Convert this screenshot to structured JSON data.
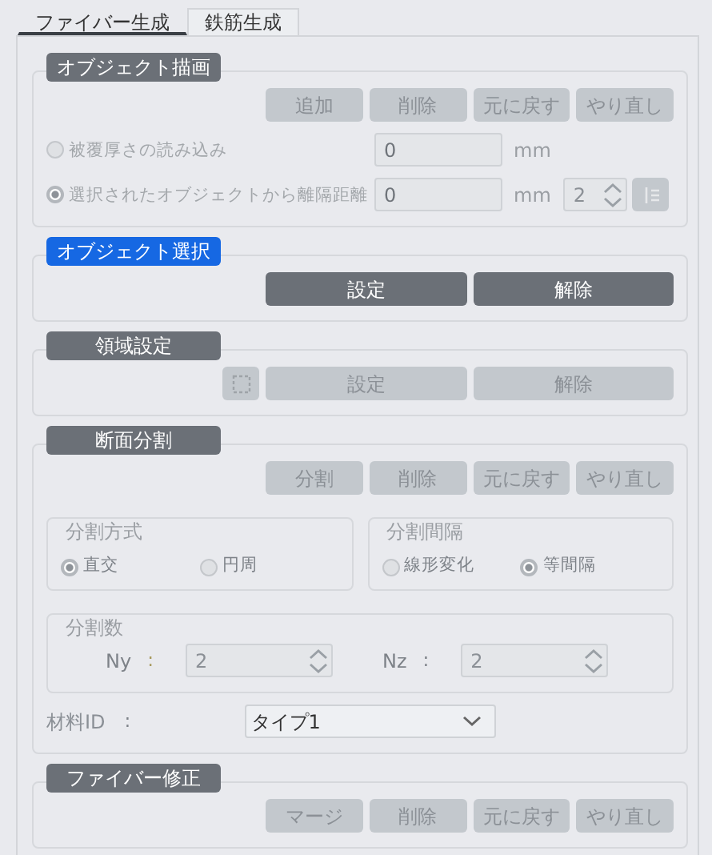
{
  "tabs": [
    {
      "label": "ファイバー生成",
      "selected": true
    },
    {
      "label": "鉄筋生成",
      "selected": false
    }
  ],
  "sections": [
    {
      "title": "オブジェクト描画",
      "selected": false,
      "buttons": [
        {
          "label": "追加",
          "disabled": true
        },
        {
          "label": "削除",
          "disabled": true
        },
        {
          "label": "元に戻す",
          "disabled": true
        },
        {
          "label": "やり直し",
          "disabled": true
        }
      ],
      "options": [
        {
          "label": "被覆厚さの読み込み",
          "checked": false,
          "value": "0",
          "unit": "mm"
        },
        {
          "label": "選択されたオブジェクトから離隔距離",
          "checked": true,
          "value": "0",
          "unit": "mm",
          "spinner": "2"
        }
      ]
    },
    {
      "title": "オブジェクト選択",
      "selected": true,
      "buttons": [
        {
          "label": "設定",
          "disabled": false
        },
        {
          "label": "解除",
          "disabled": false
        }
      ]
    },
    {
      "title": "領域設定",
      "selected": false,
      "icon_button": true,
      "buttons": [
        {
          "label": "設定",
          "disabled": true
        },
        {
          "label": "解除",
          "disabled": true
        }
      ]
    },
    {
      "title": "断面分割",
      "selected": false,
      "buttons": [
        {
          "label": "分割",
          "disabled": true
        },
        {
          "label": "削除",
          "disabled": true
        },
        {
          "label": "元に戻す",
          "disabled": true
        },
        {
          "label": "やり直し",
          "disabled": true
        }
      ],
      "groups": [
        {
          "title": "分割方式",
          "options": [
            {
              "label": "直交",
              "checked": true
            },
            {
              "label": "円周",
              "checked": false
            }
          ]
        },
        {
          "title": "分割間隔",
          "options": [
            {
              "label": "線形変化",
              "checked": false
            },
            {
              "label": "等間隔",
              "checked": true
            }
          ]
        }
      ],
      "counts": {
        "title": "分割数",
        "fields": [
          {
            "label": "Ny",
            "separator": ":",
            "value": "2"
          },
          {
            "label": "Nz",
            "separator": ":",
            "value": "2"
          }
        ]
      },
      "material": {
        "label": "材料ID",
        "separator": ":",
        "value": "タイプ1"
      }
    },
    {
      "title": "ファイバー修正",
      "selected": false,
      "buttons": [
        {
          "label": "マージ",
          "disabled": true
        },
        {
          "label": "削除",
          "disabled": true
        },
        {
          "label": "元に戻す",
          "disabled": true
        },
        {
          "label": "やり直し",
          "disabled": true
        }
      ]
    }
  ]
}
